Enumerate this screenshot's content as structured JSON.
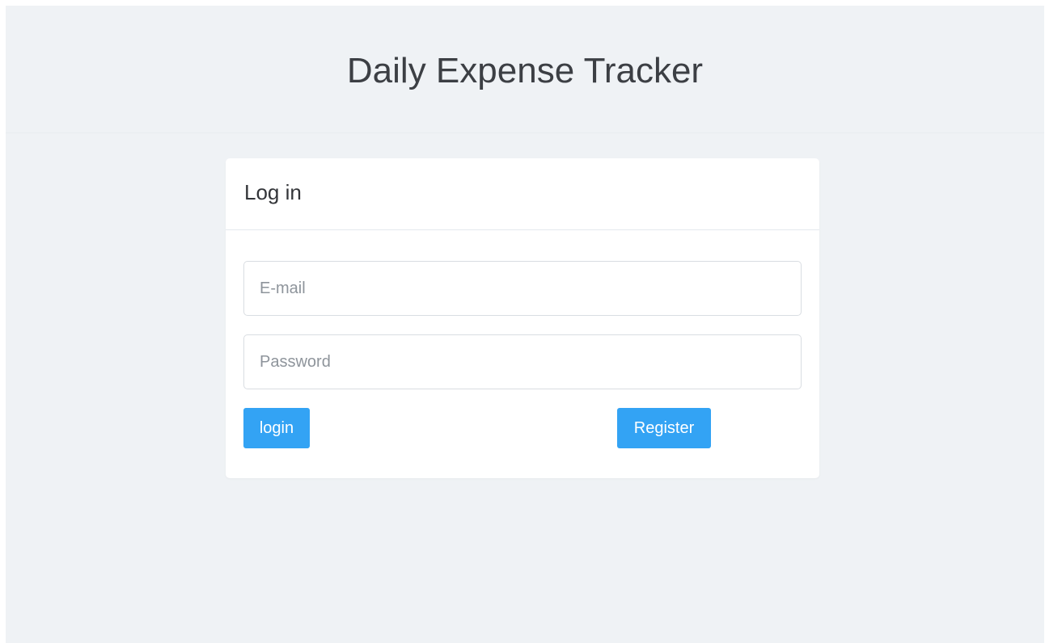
{
  "header": {
    "title": "Daily Expense Tracker"
  },
  "login_card": {
    "title": "Log in",
    "email": {
      "placeholder": "E-mail",
      "value": ""
    },
    "password": {
      "placeholder": "Password",
      "value": ""
    },
    "login_label": "login",
    "register_label": "Register"
  },
  "colors": {
    "background": "#eff2f5",
    "card": "#ffffff",
    "accent": "#33a3f4",
    "title_text": "#3c3f44"
  }
}
